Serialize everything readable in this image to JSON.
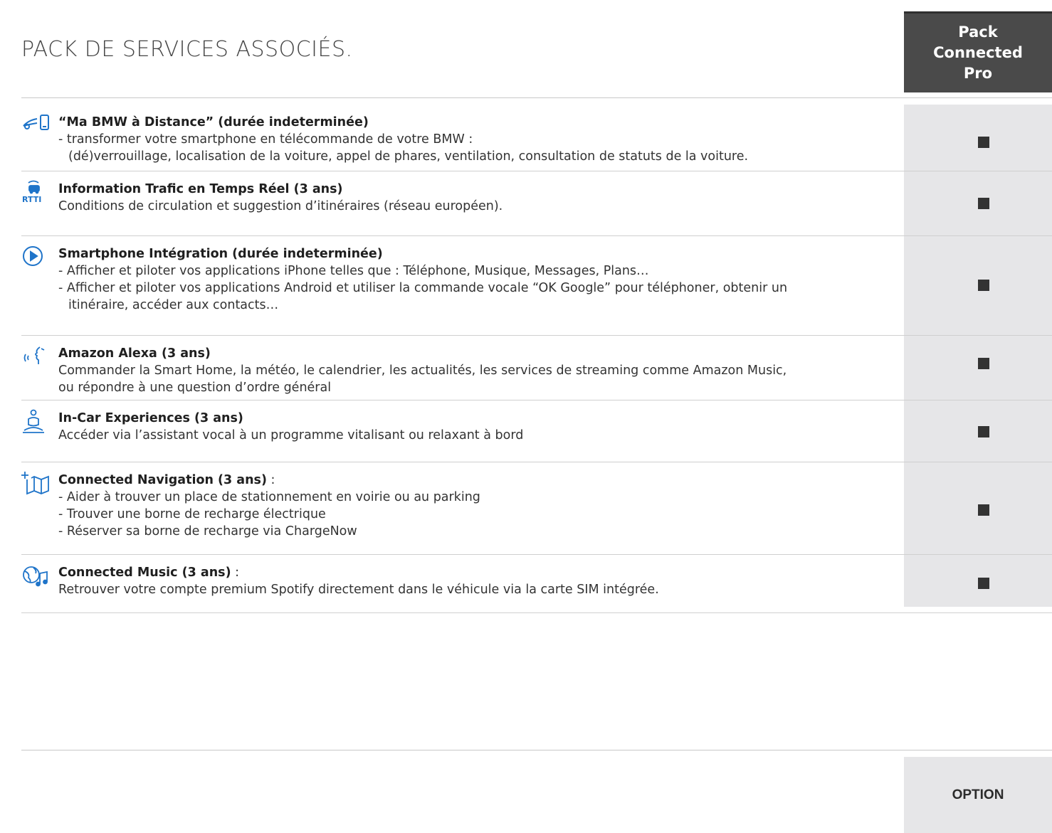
{
  "title": "PACK DE SERVICES ASSOCIÉS.",
  "pack_header": [
    "Pack",
    "Connected",
    "Pro"
  ],
  "rows": [
    {
      "icon": "remote-phone-car-icon",
      "heading": "“Ma BMW à Distance” (durée indeterminée)",
      "suffix": "",
      "lines": [
        "- transformer votre smartphone en télécommande de votre BMW :",
        "(dé)verrouillage, localisation de la voiture, appel de phares, ventilation, consultation de statuts de la voiture."
      ],
      "included": true
    },
    {
      "icon": "rtti-traffic-icon",
      "heading": "Information Trafic en Temps Réel (3 ans)",
      "suffix": "",
      "lines": [
        "Conditions de circulation et suggestion d’itinéraires (réseau européen)."
      ],
      "included": true
    },
    {
      "icon": "play-circle-icon",
      "heading": "Smartphone Intégration (durée indeterminée)",
      "suffix": "",
      "lines": [
        "- Afficher et piloter vos applications iPhone telles que : Téléphone, Musique, Messages, Plans…",
        "- Afficher et piloter vos applications Android et utiliser la commande vocale “OK Google” pour téléphoner, obtenir un",
        "itinéraire, accéder aux contacts…"
      ],
      "included": true
    },
    {
      "icon": "voice-assistant-icon",
      "heading": "Amazon Alexa (3 ans)",
      "suffix": "",
      "lines": [
        "Commander la Smart Home, la météo, le calendrier, les actualités, les services de streaming comme Amazon Music,",
        "ou répondre à une question d’ordre général"
      ],
      "included": true
    },
    {
      "icon": "meditation-person-icon",
      "heading": "In-Car Experiences (3 ans)",
      "suffix": "",
      "lines": [
        "Accéder via l’assistant vocal à un programme vitalisant ou relaxant à bord"
      ],
      "included": true
    },
    {
      "icon": "map-plus-icon",
      "heading": "Connected Navigation (3 ans)",
      "suffix": " :",
      "lines": [
        "- Aider à trouver un place de stationnement en voirie ou au parking",
        "- Trouver une borne de recharge électrique",
        "- Réserver sa borne de recharge via ChargeNow"
      ],
      "included": true
    },
    {
      "icon": "globe-music-icon",
      "heading": "Connected Music (3 ans)",
      "suffix": " :",
      "lines": [
        "Retrouver votre compte premium Spotify directement dans le véhicule via la carte SIM intégrée."
      ],
      "included": true
    }
  ],
  "option_label": "OPTION"
}
